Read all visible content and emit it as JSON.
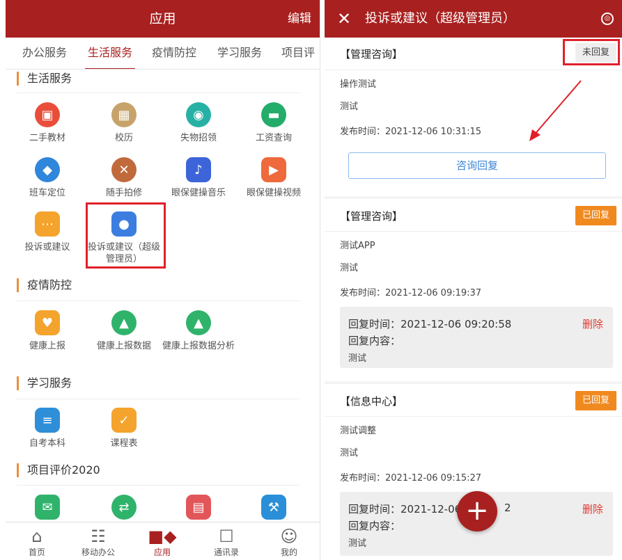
{
  "left": {
    "header": {
      "title": "应用",
      "edit": "编辑"
    },
    "tabs": [
      "办公服务",
      "生活服务",
      "疫情防控",
      "学习服务",
      "项目评"
    ],
    "sections": [
      {
        "title": "生活服务",
        "apps": [
          {
            "label": "二手教材",
            "icon": "store-icon",
            "color": "#e94e3a"
          },
          {
            "label": "校历",
            "icon": "calendar-icon",
            "color": "#c7a36b"
          },
          {
            "label": "失物招领",
            "icon": "lost-found-icon",
            "color": "#27b1a4"
          },
          {
            "label": "工资查询",
            "icon": "card-icon",
            "color": "#24ad6a"
          },
          {
            "label": "班车定位",
            "icon": "bus-icon",
            "color": "#2f86db"
          },
          {
            "label": "随手拍修",
            "icon": "tools-icon",
            "color": "#c06a3c"
          },
          {
            "label": "眼保健操音乐",
            "icon": "music-icon",
            "color": "#3d64d8"
          },
          {
            "label": "眼保健操视频",
            "icon": "video-icon",
            "color": "#ee6a3d"
          },
          {
            "label": "投诉或建议",
            "icon": "chat-icon",
            "color": "#f4a32c"
          },
          {
            "label": "投诉或建议（超级管理员）",
            "icon": "admin-icon",
            "color": "#3b7ee0"
          }
        ]
      },
      {
        "title": "疫情防控",
        "apps": [
          {
            "label": "健康上报",
            "icon": "heart-icon",
            "color": "#f4a32c"
          },
          {
            "label": "健康上报数据",
            "icon": "health-data-icon",
            "color": "#2fb36b"
          },
          {
            "label": "健康上报数据分析",
            "icon": "health-analysis-icon",
            "color": "#2fb36b"
          }
        ]
      },
      {
        "title": "学习服务",
        "apps": [
          {
            "label": "自考本科",
            "icon": "book-icon",
            "color": "#2e8ed8"
          },
          {
            "label": "课程表",
            "icon": "schedule-icon",
            "color": "#f4a32c"
          }
        ]
      },
      {
        "title": "项目评价2020",
        "apps": [
          {
            "label": "",
            "icon": "mail-icon",
            "color": "#2fb36b"
          },
          {
            "label": "",
            "icon": "link-icon",
            "color": "#2fb36b"
          },
          {
            "label": "",
            "icon": "document-icon",
            "color": "#e2565a"
          },
          {
            "label": "",
            "icon": "hammer-icon",
            "color": "#2a8fd8"
          }
        ]
      }
    ],
    "nav": [
      {
        "label": "首页",
        "icon": "home-icon"
      },
      {
        "label": "移动办公",
        "icon": "office-icon"
      },
      {
        "label": "应用",
        "icon": "apps-icon"
      },
      {
        "label": "通讯录",
        "icon": "contacts-icon"
      },
      {
        "label": "我的",
        "icon": "user-icon"
      }
    ]
  },
  "right": {
    "header": {
      "title": "投诉或建议（超级管理员）"
    },
    "cards": [
      {
        "category": "【管理咨询】",
        "status": "未回复",
        "title": "操作测试",
        "content": "测试",
        "publish": "发布时间：2021-12-06 10:31:15",
        "reply_button": "咨询回复"
      },
      {
        "category": "【管理咨询】",
        "status": "已回复",
        "title": "测试APP",
        "content": "测试",
        "publish": "发布时间：2021-12-06 09:19:37",
        "reply_time": "回复时间：2021-12-06 09:20:58",
        "reply_label": "回复内容：",
        "reply_content": "测试",
        "delete": "删除"
      },
      {
        "category": "【信息中心】",
        "status": "已回复",
        "title": "测试调整",
        "content": "测试",
        "publish": "发布时间：2021-12-06 09:15:27",
        "reply_time": "回复时间：2021-12-06",
        "reply_time_tail": "2",
        "reply_label": "回复内容：",
        "reply_content": "测试",
        "delete": "删除"
      }
    ],
    "fab": "+"
  },
  "colors": {
    "brand": "#a8201f",
    "accent_orange": "#f08a1f",
    "highlight": "#e0202a"
  }
}
